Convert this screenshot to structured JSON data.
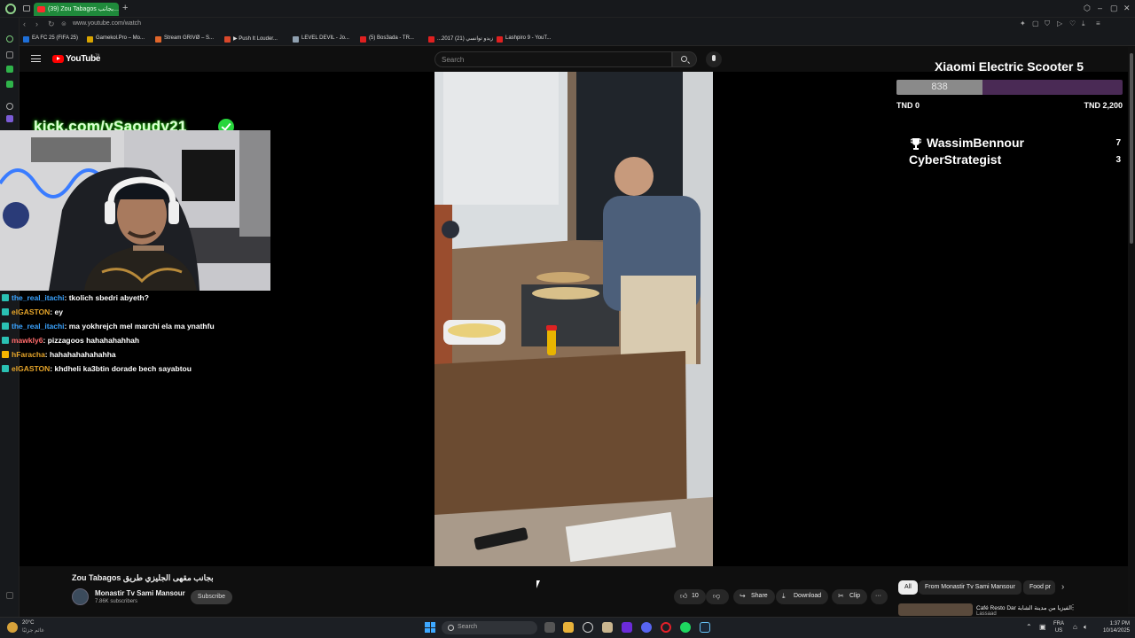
{
  "browser": {
    "active_tab_title": "(39) Zou Tabagos بجانب...",
    "url": "www.youtube.com/watch",
    "bookmarks": [
      "EA FC 25 (FIFA 25)",
      "Gamekol.Pro – Mo...",
      "Stream GRIVØ – S...",
      "▶ Push It Louder...",
      "LEVEL DEVIL - Jo...",
      "(5) Bos3ada - TR...",
      "...2017 زيدو توانسي (21)",
      "Lashpiro 9 - YouT..."
    ],
    "bookmark_colors": [
      "#1e6fd8",
      "#d9a400",
      "#e0662b",
      "#d9482b",
      "#8fa0b0",
      "#e02020",
      "#e02020",
      "#e02020"
    ]
  },
  "youtube": {
    "logo_text": "YouTube",
    "logo_tm": "TN",
    "search_placeholder": "Search"
  },
  "overlay": {
    "kick_banner": "kick.com/ySaoudy21",
    "chat": [
      {
        "user": "the_real_itachi",
        "user_color": "#3aa3ff",
        "text": ": tkolich sbedri abyeth?"
      },
      {
        "user": "elGASTON",
        "user_color": "#e6a52a",
        "text": ": ey"
      },
      {
        "user": "the_real_itachi",
        "user_color": "#3aa3ff",
        "text": ": ma yokhrejch mel marchi ela ma ynathfu"
      },
      {
        "user": "mawkly6",
        "user_color": "#ff6b6b",
        "text": ": pizzagoos hahahahahhah"
      },
      {
        "user": "hFaracha",
        "user_color": "#e6a52a",
        "text": ": hahahahahahahha"
      },
      {
        "user": "elGASTON",
        "user_color": "#e6a52a",
        "text": ": khdheli ka3btin dorade bech sayabtou"
      }
    ],
    "goal": {
      "title": "Xiaomi Electric Scooter 5",
      "current": "838",
      "current_value": 838,
      "target_value": 2200,
      "min_label": "TND 0",
      "max_label": "TND 2,200"
    },
    "leaderboard": [
      {
        "name": "WassimBennour",
        "value": "7"
      },
      {
        "name": "CyberStrategist",
        "value": "3"
      }
    ]
  },
  "video": {
    "title": "Zou Tabagos بجانب مقهى الجليزي طريق",
    "channel_name": "Monastir Tv Sami Mansour",
    "channel_subs": "7.86K subscribers",
    "subscribe_label": "Subscribe",
    "like_count": "10",
    "share_label": "Share",
    "download_label": "Download",
    "clip_label": "Clip",
    "more_label": "···"
  },
  "recommendations": {
    "chips": [
      "All",
      "From Monastir Tv Sami Mansour",
      "Food pr"
    ],
    "first_title": "Café Resto Dar الفيزيا من مدينة الشابة",
    "first_sub": "Lassaad"
  },
  "taskbar": {
    "weather_temp": "20°C",
    "weather_desc": "غائم جزئيًا",
    "search_placeholder": "Search",
    "lang_top": "FRA",
    "lang_bottom": "US",
    "time": "1:37 PM",
    "date": "10/14/2025"
  }
}
